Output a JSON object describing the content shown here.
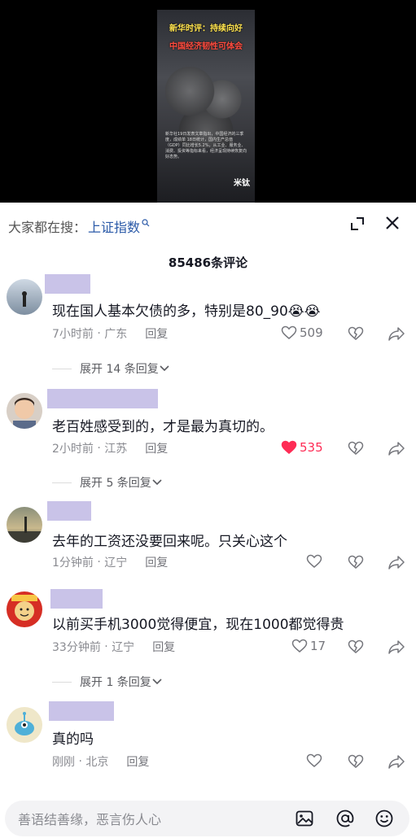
{
  "video": {
    "title_line1": "新华时评：持续向好",
    "title_line2": "中国经济韧性可体会",
    "caption": "新华社19日发表文章指出，中国经济的三季度，成绩单 18日统计，国内生产总值（GDP）同比增长5.2%，从工业、服务业、消费、投资等指标来看，经济呈现持续恢复向好态势。",
    "signature": "米钛"
  },
  "search": {
    "prefix": "大家都在搜：",
    "term": "上证指数"
  },
  "comment_count": "85486条评论",
  "comments": [
    {
      "text": "现在国人基本欠债的多，特别是80_90😭😭",
      "time": "7小时前",
      "location": "广东",
      "reply_label": "回复",
      "likes": "509",
      "liked": false,
      "expand": "展开 14 条回复"
    },
    {
      "text": "老百姓感受到的，才是最为真切的。",
      "time": "2小时前",
      "location": "江苏",
      "reply_label": "回复",
      "likes": "535",
      "liked": true,
      "expand": "展开 5 条回复"
    },
    {
      "text": "去年的工资还没要回来呢。只关心这个",
      "time": "1分钟前",
      "location": "辽宁",
      "reply_label": "回复",
      "likes": "",
      "liked": false
    },
    {
      "text": "以前买手机3000觉得便宜，现在1000都觉得贵",
      "time": "33分钟前",
      "location": "辽宁",
      "reply_label": "回复",
      "likes": "17",
      "liked": false,
      "expand": "展开 1 条回复"
    },
    {
      "text": "真的吗",
      "time": "刚刚",
      "location": "北京",
      "reply_label": "回复",
      "likes": "",
      "liked": false
    }
  ],
  "input": {
    "placeholder": "善语结善缘，恶言伤人心"
  },
  "colors": {
    "accent_like": "#fe2c55",
    "link": "#2b5aa8",
    "username_redaction": "#c9c3e8"
  }
}
